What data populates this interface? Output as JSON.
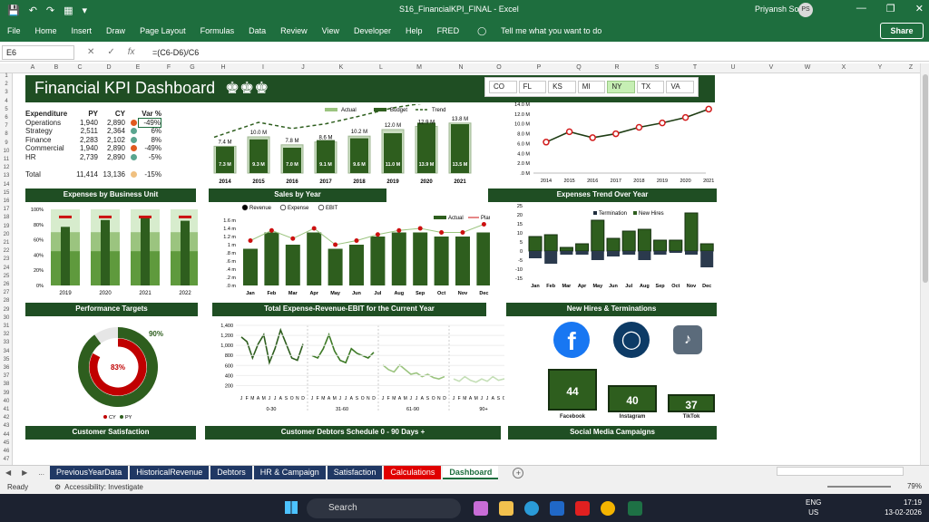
{
  "window": {
    "title": "S16_FinancialKPI_FINAL  -  Excel",
    "user": "Priyansh Soni",
    "avatar": "PS"
  },
  "menu": [
    "File",
    "Home",
    "Insert",
    "Draw",
    "Page Layout",
    "Formulas",
    "Data",
    "Review",
    "View",
    "Developer",
    "Help",
    "FRED"
  ],
  "tell_me": "Tell me what you want to do",
  "share": "Share",
  "formula_bar": {
    "name_box": "E6",
    "formula": "=(C6-D6)/C6"
  },
  "columns": [
    "A",
    "B",
    "C",
    "D",
    "E",
    "F",
    "G",
    "H",
    "I",
    "J",
    "K",
    "L",
    "M",
    "N",
    "O",
    "P",
    "Q",
    "R",
    "S",
    "T",
    "U",
    "V",
    "W",
    "X",
    "Y",
    "Z"
  ],
  "rows": [
    "1",
    "2",
    "3",
    "4",
    "5",
    "6",
    "7",
    "8",
    "9",
    "10",
    "11",
    "12",
    "13",
    "14",
    "15",
    "16",
    "17",
    "18",
    "19",
    "20",
    "21",
    "22",
    "23",
    "24",
    "25",
    "26",
    "27",
    "28",
    "29",
    "30",
    "31",
    "32",
    "33",
    "34",
    "35",
    "36",
    "37",
    "38",
    "39",
    "40",
    "41",
    "42",
    "43",
    "44",
    "45",
    "46",
    "47"
  ],
  "dashboard": {
    "title": "Financial KPI Dashboard",
    "slicer": [
      {
        "label": "CO",
        "selected": false
      },
      {
        "label": "FL",
        "selected": false
      },
      {
        "label": "KS",
        "selected": false
      },
      {
        "label": "MI",
        "selected": false
      },
      {
        "label": "NY",
        "selected": true
      },
      {
        "label": "TX",
        "selected": false
      },
      {
        "label": "VA",
        "selected": false
      }
    ],
    "expenditure": {
      "headers": [
        "Expenditure",
        "PY",
        "CY",
        "Var %"
      ],
      "rows": [
        {
          "name": "Operations",
          "py": "1,940",
          "cy": "2,890",
          "var": "-49%",
          "color": "#e05a1f"
        },
        {
          "name": "Strategy",
          "py": "2,511",
          "cy": "2,364",
          "var": "6%",
          "color": "#5aa58f"
        },
        {
          "name": "Finance",
          "py": "2,283",
          "cy": "2,102",
          "var": "8%",
          "color": "#5aa58f"
        },
        {
          "name": "Commercial",
          "py": "1,940",
          "cy": "2,890",
          "var": "-49%",
          "color": "#e05a1f"
        },
        {
          "name": "HR",
          "py": "2,739",
          "cy": "2,890",
          "var": "-5%",
          "color": "#5aa58f"
        }
      ],
      "total": {
        "name": "Total",
        "py": "11,414",
        "cy": "13,136",
        "var": "-15%",
        "color": "#f0c080"
      }
    },
    "sections": {
      "expenses_by_bu": "Expenses by Business Unit",
      "sales_by_year": "Sales by Year",
      "expenses_trend": "Expenses Trend Over Year",
      "performance": "Performance Targets",
      "total_exp": "Total Expense-Revenue-EBIT for the Current Year",
      "hires": "New Hires & Terminations",
      "customer_sat": "Customer Satisfaction",
      "debtors": "Customer Debtors Schedule 0 - 90 Days +",
      "social": "Social  Media Campaigns"
    },
    "radio": [
      "Revenue",
      "Expense",
      "EBIT"
    ],
    "social": [
      {
        "name": "Facebook",
        "value": "44"
      },
      {
        "name": "Instagram",
        "value": "40"
      },
      {
        "name": "TikTok",
        "value": "37"
      }
    ]
  },
  "chart_data": [
    {
      "type": "bar",
      "title": "",
      "legend": [
        "Actual",
        "Budget",
        "Trend"
      ],
      "categories": [
        "2014",
        "2015",
        "2016",
        "2017",
        "2018",
        "2019",
        "2020",
        "2021"
      ],
      "series": [
        {
          "name": "Budget",
          "values": [
            7.4,
            10.0,
            7.8,
            8.6,
            10.2,
            12.0,
            12.9,
            13.8
          ]
        },
        {
          "name": "Actual",
          "values": [
            7.3,
            9.3,
            7.0,
            9.1,
            9.6,
            11.0,
            13.9,
            13.5
          ]
        }
      ],
      "data_labels_top": [
        "7.4 M",
        "10.0 M",
        "7.8 M",
        "8.6 M",
        "10.2 M",
        "12.0 M",
        "12.9 M",
        "13.8 M"
      ],
      "data_labels_inside": [
        "7.3 M",
        "9.3 M",
        "7.0 M",
        "9.1 M",
        "9.6 M",
        "11.0 M",
        "13.9 M",
        "13.5 M"
      ]
    },
    {
      "type": "line",
      "x": [
        "2014",
        "2015",
        "2016",
        "2017",
        "2018",
        "2019",
        "2020",
        "2021"
      ],
      "values": [
        6.3,
        8.4,
        7.2,
        8.0,
        9.3,
        10.2,
        11.3,
        13.0
      ],
      "yticks": [
        "14.0 M",
        "12.0 M",
        "10.0 M",
        "8.0 M",
        "6.0 M",
        "4.0 M",
        "2.0 M",
        ".0 M"
      ],
      "ylim": [
        0,
        14
      ]
    },
    {
      "type": "bar",
      "categories": [
        "2019",
        "2020",
        "2021",
        "2022"
      ],
      "yticks": [
        "100%",
        "80%",
        "60%",
        "40%",
        "20%",
        "0%"
      ],
      "target": [
        90,
        90,
        90,
        90
      ],
      "band": [
        100,
        100,
        100,
        100
      ],
      "inner": [
        77,
        86,
        90,
        85
      ],
      "ylim": [
        0,
        100
      ]
    },
    {
      "type": "bar",
      "legend": [
        "Actual",
        "Plan"
      ],
      "categories": [
        "Jan",
        "Feb",
        "Mar",
        "Apr",
        "May",
        "Jun",
        "Jul",
        "Aug",
        "Sep",
        "Oct",
        "Nov",
        "Dec"
      ],
      "yticks": [
        "1.6 m",
        "1.4 m",
        "1.2 m",
        "1 m",
        ".8 m",
        ".6 m",
        ".4 m",
        ".2 m",
        ".0 m"
      ],
      "actual": [
        0.9,
        1.3,
        1.0,
        1.3,
        0.9,
        1.0,
        1.2,
        1.3,
        1.3,
        1.2,
        1.2,
        1.3
      ],
      "plan": [
        1.1,
        1.35,
        1.15,
        1.4,
        1.0,
        1.1,
        1.25,
        1.35,
        1.4,
        1.3,
        1.3,
        1.5
      ],
      "ylim": [
        0,
        1.6
      ]
    },
    {
      "type": "bar",
      "legend": [
        "Termination",
        "New Hires"
      ],
      "categories": [
        "Jan",
        "Feb",
        "Mar",
        "Apr",
        "May",
        "Jun",
        "Jul",
        "Aug",
        "Sep",
        "Oct",
        "Nov",
        "Dec"
      ],
      "yticks": [
        "25",
        "20",
        "15",
        "10",
        "5",
        "0",
        "-5",
        "-10",
        "-15"
      ],
      "new_hires": [
        8,
        9,
        2,
        4,
        17,
        7,
        11,
        12,
        6,
        6,
        21,
        4
      ],
      "terminations": [
        -4,
        -7,
        -2,
        -2,
        -5,
        -3,
        -2,
        -5,
        -2,
        -1,
        -2,
        -9
      ],
      "ylim": [
        -15,
        25
      ]
    },
    {
      "type": "pie",
      "values": [
        83,
        90
      ],
      "labels": [
        "83%",
        "90%"
      ],
      "legend": [
        "CY",
        "PY"
      ]
    },
    {
      "type": "line",
      "yticks": [
        "1,400",
        "1,200",
        "1,000",
        "800",
        "600",
        "400",
        "200"
      ],
      "months": [
        "J",
        "F",
        "M",
        "A",
        "M",
        "J",
        "J",
        "A",
        "S",
        "O",
        "N",
        "D"
      ],
      "groups": [
        "0-30",
        "31-60",
        "61-90",
        "90+"
      ],
      "series": [
        {
          "name": "0-30",
          "values": [
            1150,
            1050,
            700,
            1000,
            1200,
            600,
            900,
            1300,
            1000,
            700,
            650,
            1000
          ]
        },
        {
          "name": "31-60",
          "values": [
            750,
            700,
            900,
            1200,
            850,
            650,
            600,
            900,
            800,
            750,
            700,
            820
          ]
        },
        {
          "name": "61-90",
          "values": [
            550,
            450,
            400,
            550,
            450,
            350,
            380,
            300,
            350,
            280,
            250,
            300
          ]
        },
        {
          "name": "90+",
          "values": [
            250,
            200,
            300,
            220,
            180,
            250,
            200,
            300,
            220,
            250,
            200,
            230
          ]
        }
      ],
      "ylim": [
        0,
        1400
      ]
    }
  ],
  "tabs": [
    {
      "label": "PreviousYearData",
      "style": "blue"
    },
    {
      "label": "HistoricalRevenue",
      "style": "blue"
    },
    {
      "label": "Debtors",
      "style": "blue"
    },
    {
      "label": "HR & Campaign",
      "style": "blue"
    },
    {
      "label": "Satisfaction",
      "style": "blue"
    },
    {
      "label": "Calculations",
      "style": "red"
    },
    {
      "label": "Dashboard",
      "style": "active"
    }
  ],
  "status": {
    "ready": "Ready",
    "accessibility": "Accessibility: Investigate",
    "zoom": "79%"
  },
  "taskbar": {
    "search": "Search",
    "lang1": "ENG",
    "lang2": "US",
    "time": "17:19",
    "date": "13-02-2026"
  }
}
